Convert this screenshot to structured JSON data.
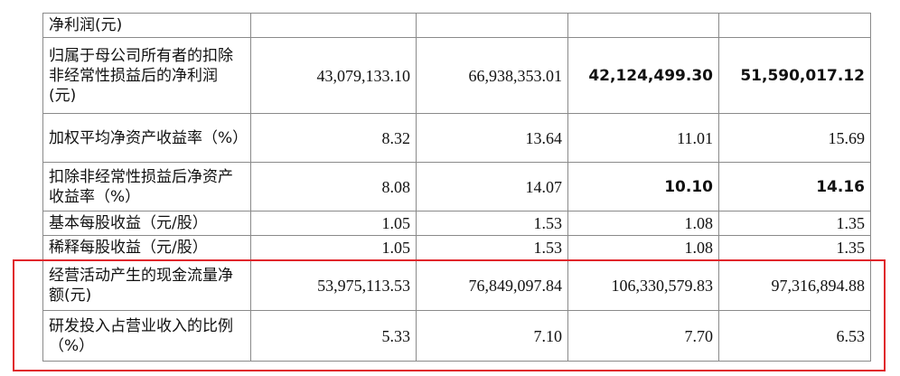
{
  "highlight_color": "#e0262b",
  "rows": [
    {
      "label": "净利润(元)",
      "values": [
        "",
        "",
        "",
        ""
      ],
      "bold": [
        false,
        false,
        false,
        false
      ]
    },
    {
      "label": "归属于母公司所有者的扣除非经常性损益后的净利润(元)",
      "values": [
        "43,079,133.10",
        "66,938,353.01",
        "42,124,499.30",
        "51,590,017.12"
      ],
      "bold": [
        false,
        false,
        true,
        true
      ]
    },
    {
      "label": "加权平均净资产收益率（%）",
      "values": [
        "8.32",
        "13.64",
        "11.01",
        "15.69"
      ],
      "bold": [
        false,
        false,
        false,
        false
      ]
    },
    {
      "label": "扣除非经常性损益后净资产收益率（%）",
      "values": [
        "8.08",
        "14.07",
        "10.10",
        "14.16"
      ],
      "bold": [
        false,
        false,
        true,
        true
      ]
    },
    {
      "label": "基本每股收益（元/股）",
      "values": [
        "1.05",
        "1.53",
        "1.08",
        "1.35"
      ],
      "bold": [
        false,
        false,
        false,
        false
      ]
    },
    {
      "label": "稀释每股收益（元/股）",
      "values": [
        "1.05",
        "1.53",
        "1.08",
        "1.35"
      ],
      "bold": [
        false,
        false,
        false,
        false
      ]
    },
    {
      "label": "经营活动产生的现金流量净额(元)",
      "values": [
        "53,975,113.53",
        "76,849,097.84",
        "106,330,579.83",
        "97,316,894.88"
      ],
      "bold": [
        false,
        false,
        false,
        false
      ]
    },
    {
      "label": "研发投入占营业收入的比例（%）",
      "values": [
        "5.33",
        "7.10",
        "7.70",
        "6.53"
      ],
      "bold": [
        false,
        false,
        false,
        false
      ]
    }
  ]
}
